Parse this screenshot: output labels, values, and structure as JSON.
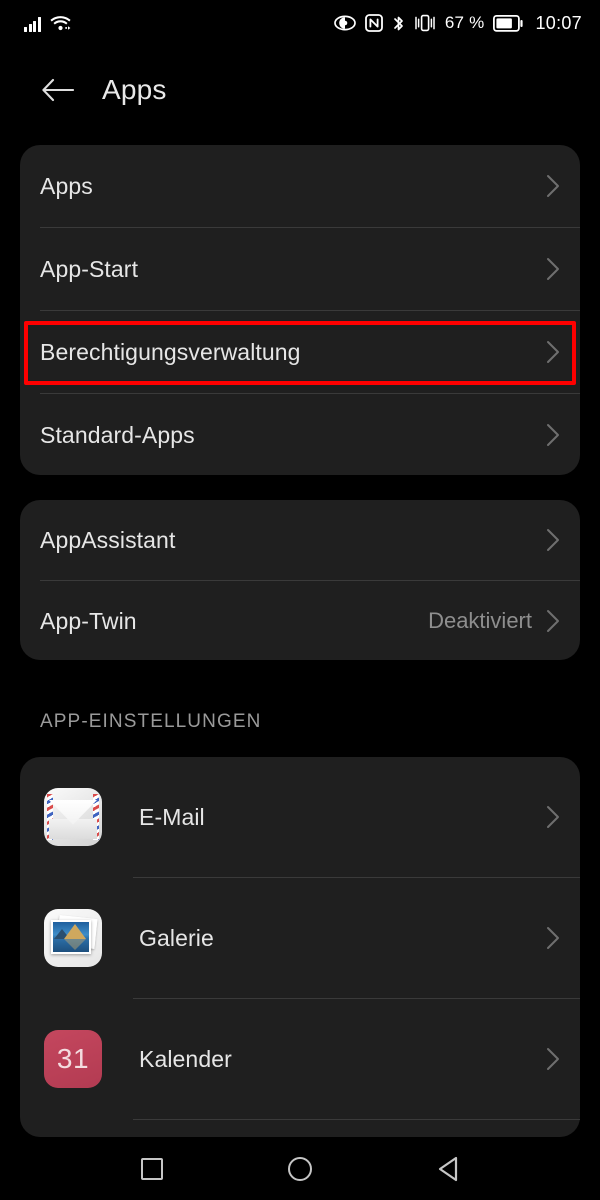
{
  "statusbar": {
    "signal_icon": "cellular-signal-icon",
    "wifi_icon": "wifi-icon",
    "eye_icon": "eye-comfort-icon",
    "nfc_icon": "nfc-icon",
    "bluetooth_icon": "bluetooth-icon",
    "vibrate_icon": "vibrate-icon",
    "battery_percent": "67 %",
    "battery_icon": "battery-icon",
    "clock": "10:07"
  },
  "header": {
    "back_icon": "back-arrow-icon",
    "title": "Apps"
  },
  "cards": {
    "main": [
      {
        "label": "Apps",
        "value": ""
      },
      {
        "label": "App-Start",
        "value": ""
      },
      {
        "label": "Berechtigungsverwaltung",
        "value": ""
      },
      {
        "label": "Standard-Apps",
        "value": ""
      }
    ],
    "assistant": [
      {
        "label": "AppAssistant",
        "value": ""
      },
      {
        "label": "App-Twin",
        "value": "Deaktiviert"
      }
    ]
  },
  "section": {
    "app_settings_label": "APP-EINSTELLUNGEN"
  },
  "apps": [
    {
      "label": "E-Mail",
      "icon": "mail-app-icon"
    },
    {
      "label": "Galerie",
      "icon": "gallery-app-icon"
    },
    {
      "label": "Kalender",
      "icon": "calendar-app-icon",
      "badge": "31"
    }
  ],
  "highlight": {
    "target_label": "Berechtigungsverwaltung",
    "color": "#ff0000"
  },
  "navbar": {
    "recents_icon": "recents-square-icon",
    "home_icon": "home-circle-icon",
    "back_icon": "back-triangle-icon"
  },
  "colors": {
    "background": "#000000",
    "card": "#1f1f1f",
    "text_primary": "#e6e6e6",
    "text_secondary": "#8e8e8e",
    "divider": "#3a3a3a",
    "calendar_red": "#c4475e"
  }
}
